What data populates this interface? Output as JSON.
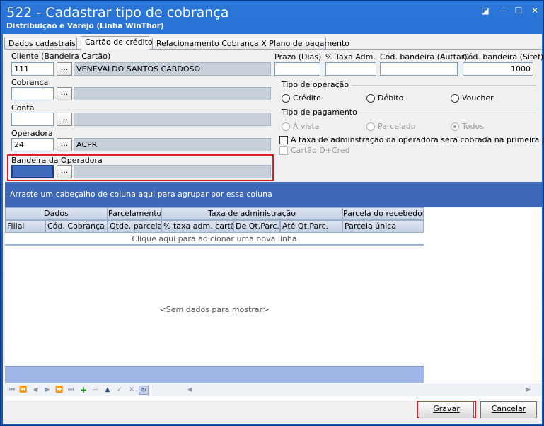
{
  "window": {
    "title": "522 - Cadastrar tipo de cobrança",
    "subtitle": "Distribuição e Varejo (Linha WinThor)",
    "controls": {
      "restore": "◪",
      "minimize": "—",
      "maximize": "☐",
      "close": "✕"
    }
  },
  "tabs": [
    {
      "label": "Dados cadastrais"
    },
    {
      "label": "Cartão de crédito"
    },
    {
      "label": "Relacionamento Cobrança X Plano de pagamento"
    }
  ],
  "form": {
    "cliente": {
      "label": "Cliente (Bandeira Cartão)",
      "code": "111",
      "desc": "VENEVALDO SANTOS CARDOSO"
    },
    "cobranca": {
      "label": "Cobrança",
      "code": "",
      "desc": ""
    },
    "conta": {
      "label": "Conta",
      "code": "",
      "desc": ""
    },
    "operadora": {
      "label": "Operadora",
      "code": "24",
      "desc": "ACPR"
    },
    "bandeira": {
      "label": "Bandeira da Operadora",
      "code": "",
      "desc": ""
    },
    "dots_label": "...",
    "prazo": {
      "label": "Prazo (Dias)",
      "value": ""
    },
    "taxa": {
      "label": "% Taxa Adm.",
      "value": ""
    },
    "cod_auttar": {
      "label": "Cód. bandeira (Auttar)",
      "value": ""
    },
    "cod_sitef": {
      "label": "Cód. bandeira (Sitef)",
      "value": "1000"
    },
    "tipo_operacao": {
      "label": "Tipo de operação",
      "options": [
        "Crédito",
        "Débito",
        "Voucher"
      ]
    },
    "tipo_pagamento": {
      "label": "Tipo de pagamento",
      "options": [
        "À vista",
        "Parcelado",
        "Todos"
      ],
      "selected": "Todos"
    },
    "taxa_primeira": "A taxa de adminstração da operadora será cobrada na primeira parcela",
    "cartao_dcred": "Cartão D+Cred"
  },
  "grid": {
    "group_hint": "Arraste um cabeçalho de coluna aqui para agrupar por essa coluna",
    "bands": [
      "Dados",
      "Parcelamento",
      "Taxa de administração",
      "Parcela do recebedor"
    ],
    "columns": [
      "Filial",
      "Cód. Cobrança",
      "Qtde. parcelas",
      "% taxa adm. cartão",
      "De Qt.Parc.",
      "Até Qt.Parc.",
      "Parcela única"
    ],
    "new_row": "Clique aqui para adicionar uma nova linha",
    "no_data": "<Sem dados para mostrar>"
  },
  "navigator": [
    "⏮",
    "⏪",
    "◀",
    "▶",
    "⏩",
    "⏭",
    "+",
    "—",
    "▲",
    "✓",
    "✕",
    "↻"
  ],
  "buttons": {
    "save": "Gravar",
    "cancel": "Cancelar"
  },
  "colors": {
    "title_bar": "#1356b5",
    "group_bar": "#3f68b8",
    "highlight": "#e02020"
  }
}
